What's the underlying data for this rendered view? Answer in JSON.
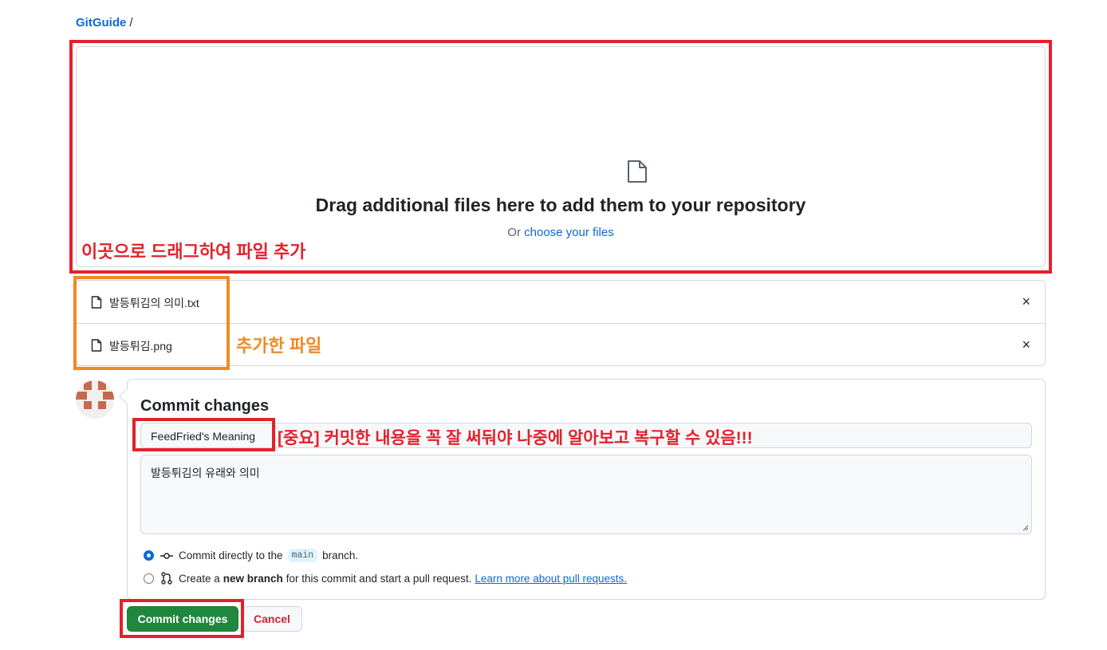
{
  "breadcrumb": {
    "repo": "GitGuide",
    "separator": "/"
  },
  "dropzone": {
    "title": "Drag additional files here to add them to your repository",
    "choose_prefix": "Or",
    "choose_link": "choose your files"
  },
  "annotations": {
    "drop_note": "이곳으로 드래그하여 파일 추가",
    "files_note": "추가한 파일",
    "message_note": "[중요] 커밋한 내용을 꼭 잘 써둬야 나중에 알아보고 복구할 수 있음!!!",
    "colors": {
      "red": "#e3212b",
      "orange": "#f08a24"
    }
  },
  "files": [
    {
      "name": "발등튀김의 의미.txt",
      "remove": "×"
    },
    {
      "name": "발등튀김.png",
      "remove": "×"
    }
  ],
  "commit": {
    "title": "Commit changes",
    "summary_value": "FeedFried's Meaning",
    "description_value": "발등튀김의 유래와 의미",
    "option_direct": {
      "prefix": "Commit directly to the",
      "branch": "main",
      "suffix": "branch."
    },
    "option_new": {
      "prefix": "Create a",
      "bold": "new branch",
      "suffix": "for this commit and start a pull request.",
      "link": "Learn more about pull requests."
    },
    "commit_button": "Commit changes",
    "cancel_button": "Cancel"
  },
  "icons": [
    "file-icon",
    "close-icon",
    "git-commit-icon",
    "git-pull-request-icon",
    "avatar"
  ],
  "colors": {
    "accent": "#0969da",
    "primary_button": "#1f883d",
    "danger": "#d1242f"
  }
}
